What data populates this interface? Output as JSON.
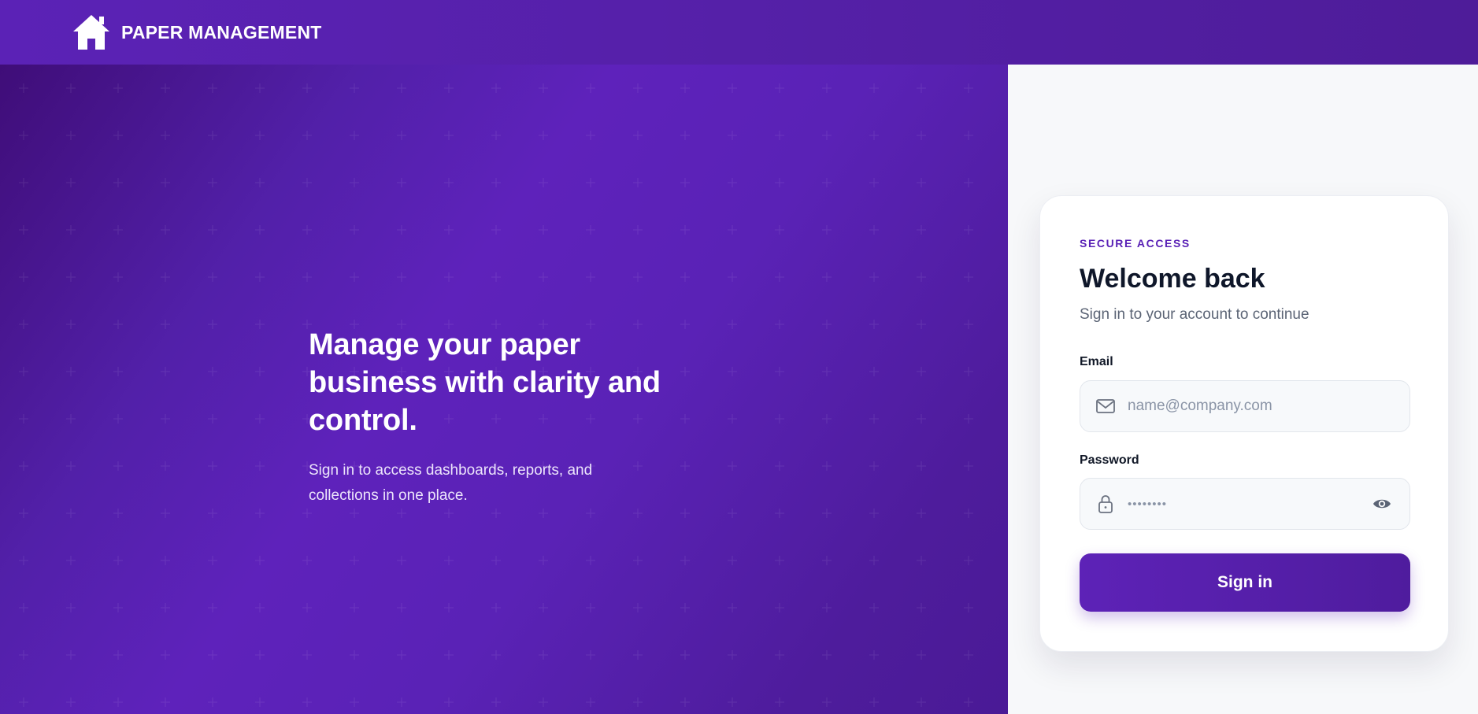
{
  "header": {
    "brand_name": "PAPER MANAGEMENT",
    "brand_icon": "house-icon"
  },
  "hero": {
    "title": "Manage your paper business with clarity and control.",
    "subtitle": "Sign in to access dashboards, reports, and collections in one place."
  },
  "login": {
    "eyebrow": "SECURE ACCESS",
    "title": "Welcome back",
    "subtitle": "Sign in to your account to continue",
    "email_label": "Email",
    "email_placeholder": "name@company.com",
    "email_icon": "mail-icon",
    "password_label": "Password",
    "password_value": "••••••••",
    "password_icon": "lock-icon",
    "password_toggle_icon": "eye-icon",
    "submit_label": "Sign in"
  },
  "colors": {
    "brand_purple": "#5a22b6",
    "title_dark": "#0f172a",
    "muted_text": "#5b6475",
    "field_bg": "#f7f9fb"
  }
}
